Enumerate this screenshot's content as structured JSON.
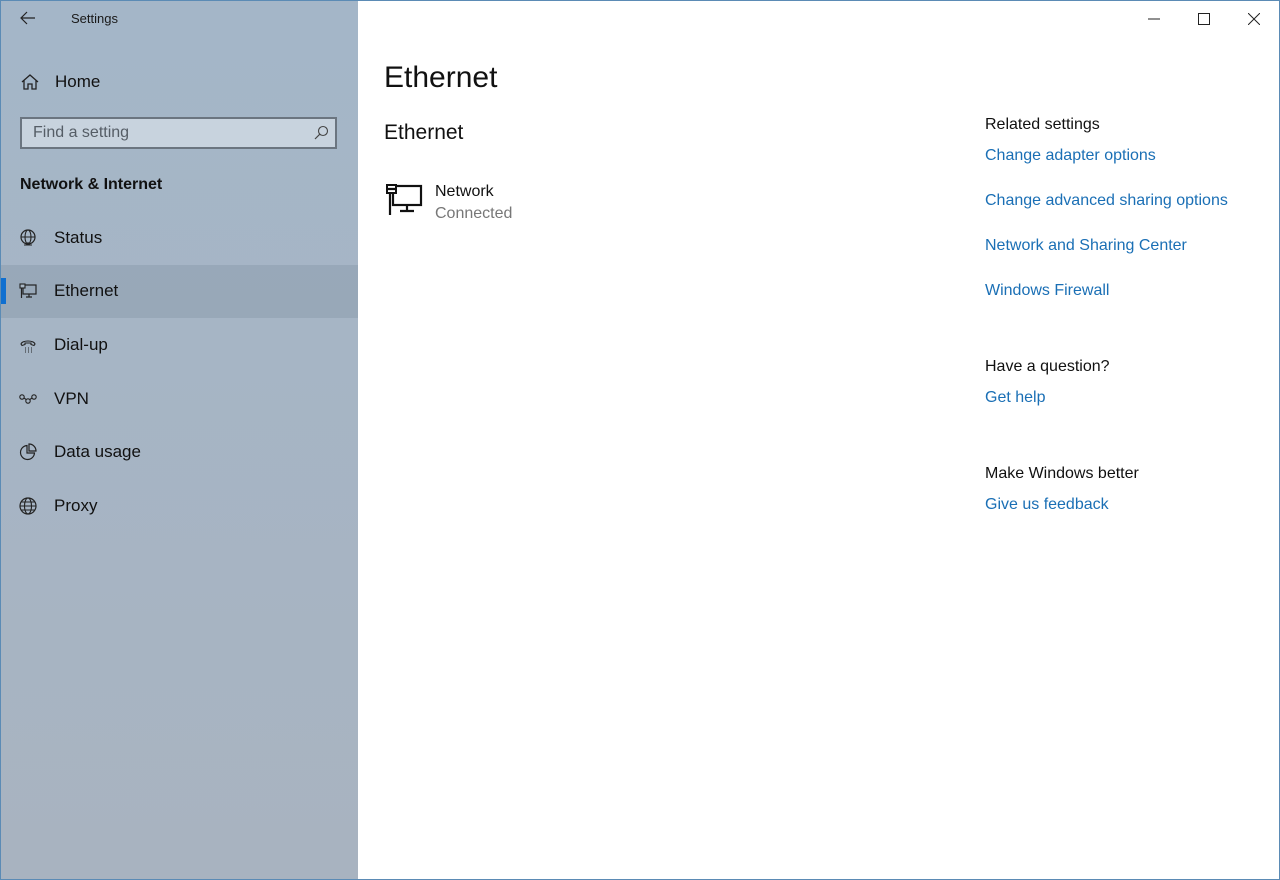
{
  "app": {
    "title": "Settings",
    "back_icon": "arrow-left-icon"
  },
  "sidebar": {
    "home_label": "Home",
    "search_placeholder": "Find a setting",
    "search_value": "",
    "section_title": "Network & Internet",
    "items": [
      {
        "label": "Status",
        "icon": "globe-monitor-icon",
        "active": false
      },
      {
        "label": "Ethernet",
        "icon": "ethernet-icon",
        "active": true
      },
      {
        "label": "Dial-up",
        "icon": "phone-icon",
        "active": false
      },
      {
        "label": "VPN",
        "icon": "vpn-icon",
        "active": false
      },
      {
        "label": "Data usage",
        "icon": "pie-chart-icon",
        "active": false
      },
      {
        "label": "Proxy",
        "icon": "globe-icon",
        "active": false
      }
    ]
  },
  "window_controls": [
    "minimize",
    "maximize",
    "close"
  ],
  "main": {
    "page_title": "Ethernet",
    "section_title": "Ethernet",
    "network": {
      "name": "Network",
      "status": "Connected"
    },
    "related": {
      "heading": "Related settings",
      "links": [
        "Change adapter options",
        "Change advanced sharing options",
        "Network and Sharing Center",
        "Windows Firewall"
      ]
    },
    "question": {
      "heading": "Have a question?",
      "link": "Get help"
    },
    "feedback": {
      "heading": "Make Windows better",
      "link": "Give us feedback"
    }
  },
  "colors": {
    "accent": "#0f6fd0",
    "link": "#1a6fb5"
  }
}
